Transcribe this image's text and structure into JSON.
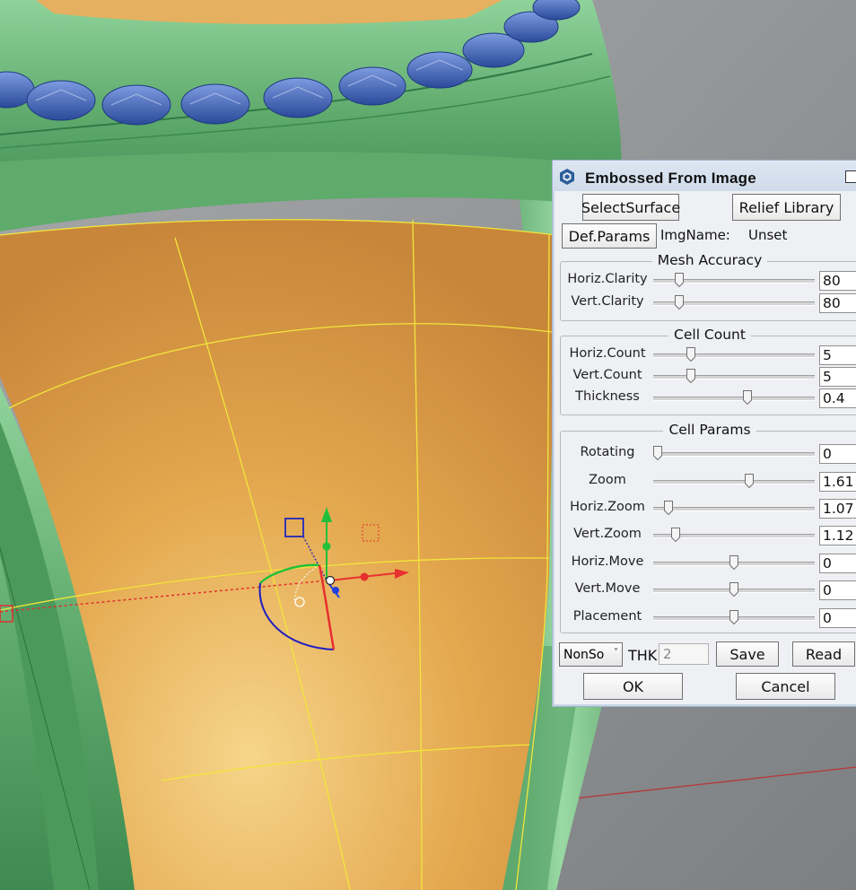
{
  "dialog": {
    "title": "Embossed From Image",
    "select_surface": "SelectSurface",
    "relief_library": "Relief Library",
    "def_params": "Def.Params",
    "img_name_label": "ImgName:",
    "img_name_value": "Unset"
  },
  "mesh_accuracy": {
    "title": "Mesh Accuracy",
    "rows": [
      {
        "label": "Horiz.Clarity",
        "value": "80",
        "slider_fraction": 0.14
      },
      {
        "label": "Vert.Clarity",
        "value": "80",
        "slider_fraction": 0.14
      }
    ]
  },
  "cell_count": {
    "title": "Cell Count",
    "rows": [
      {
        "label": "Horiz.Count",
        "value": "5",
        "slider_fraction": 0.22
      },
      {
        "label": "Vert.Count",
        "value": "5",
        "slider_fraction": 0.22
      },
      {
        "label": "Thickness",
        "value": "0.4",
        "slider_fraction": 0.59
      }
    ]
  },
  "cell_params": {
    "title": "Cell Params",
    "rows": [
      {
        "label": "Rotating",
        "value": "0",
        "slider_fraction": 0.0
      },
      {
        "label": "Zoom",
        "value": "1.61",
        "slider_fraction": 0.6
      },
      {
        "label": "Horiz.Zoom",
        "value": "1.07",
        "slider_fraction": 0.07
      },
      {
        "label": "Vert.Zoom",
        "value": "1.12",
        "slider_fraction": 0.12
      },
      {
        "label": "Horiz.Move",
        "value": "0",
        "slider_fraction": 0.5
      },
      {
        "label": "Vert.Move",
        "value": "0",
        "slider_fraction": 0.5
      },
      {
        "label": "Placement",
        "value": "0",
        "slider_fraction": 0.5
      }
    ]
  },
  "footer": {
    "mode_select": "NonSo",
    "thk_label": "THK",
    "thk_value": "2",
    "save": "Save",
    "read": "Read",
    "ok": "OK",
    "cancel": "Cancel"
  },
  "colors": {
    "ring_green": "#6db07a",
    "surface_orange": "#e2a24a",
    "gem_blue": "#3f63b3",
    "panel_bg": "#eef0f3"
  }
}
